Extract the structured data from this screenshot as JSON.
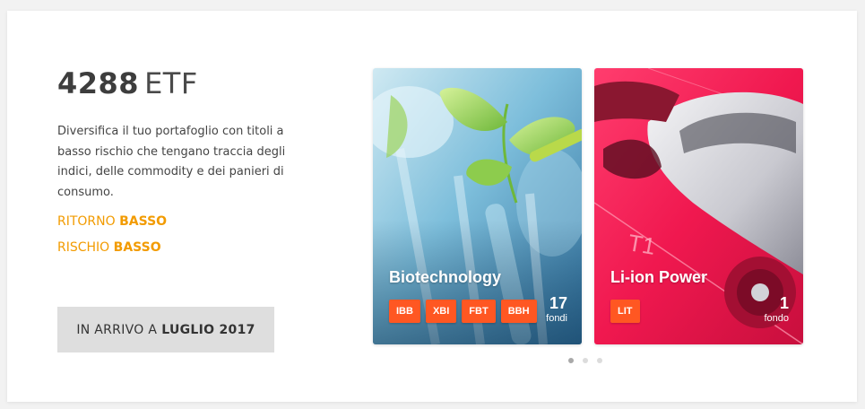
{
  "header": {
    "count": "4288",
    "unit": "ETF"
  },
  "description": "Diversifica il tuo portafoglio con titoli a basso rischio che tengano traccia degli indici, delle commodity e dei panieri di consumo.",
  "stats": [
    {
      "label": "RITORNO",
      "value": "BASSO"
    },
    {
      "label": "RISCHIO",
      "value": "BASSO"
    }
  ],
  "cta": {
    "prefix": "IN ARRIVO A",
    "date": "LUGLIO 2017"
  },
  "cards": [
    {
      "title": "Biotechnology",
      "tags": [
        "IBB",
        "XBI",
        "FBT",
        "BBH"
      ],
      "count": "17",
      "count_label": "fondi"
    },
    {
      "title": "Li-ion Power",
      "tags": [
        "LIT"
      ],
      "count": "1",
      "count_label": "fondo"
    }
  ],
  "colors": {
    "accent": "#f29b00",
    "tag": "#ff5722"
  }
}
